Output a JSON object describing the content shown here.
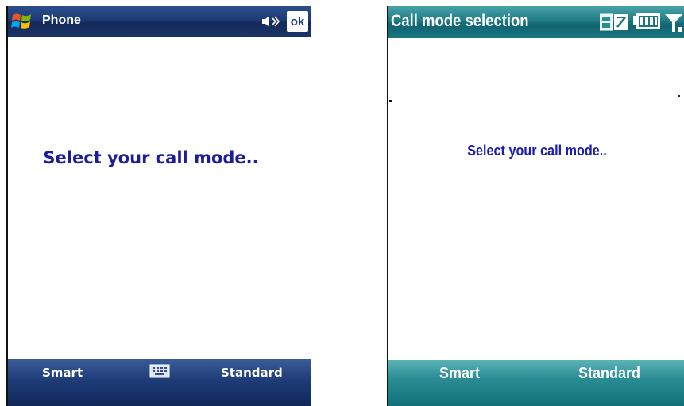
{
  "left_phone": {
    "title": "Phone",
    "ok_label": "ok",
    "message": "Select your call mode..",
    "softkeys": {
      "left": "Smart",
      "right": "Standard"
    },
    "icons": [
      "windows-start-icon",
      "speaker-icon",
      "keyboard-icon"
    ],
    "colors": {
      "titlebar": "#1d3a74",
      "message": "#1c1c9c"
    }
  },
  "right_phone": {
    "title": "Call mode selection",
    "message": "Select your call mode..",
    "softkeys": {
      "left": "Smart",
      "right": "Standard"
    },
    "icons": [
      "sim-status-icon",
      "battery-icon",
      "signal-strength-icon"
    ],
    "colors": {
      "titlebar": "#1f7d86",
      "message": "#1c1cb4"
    }
  }
}
